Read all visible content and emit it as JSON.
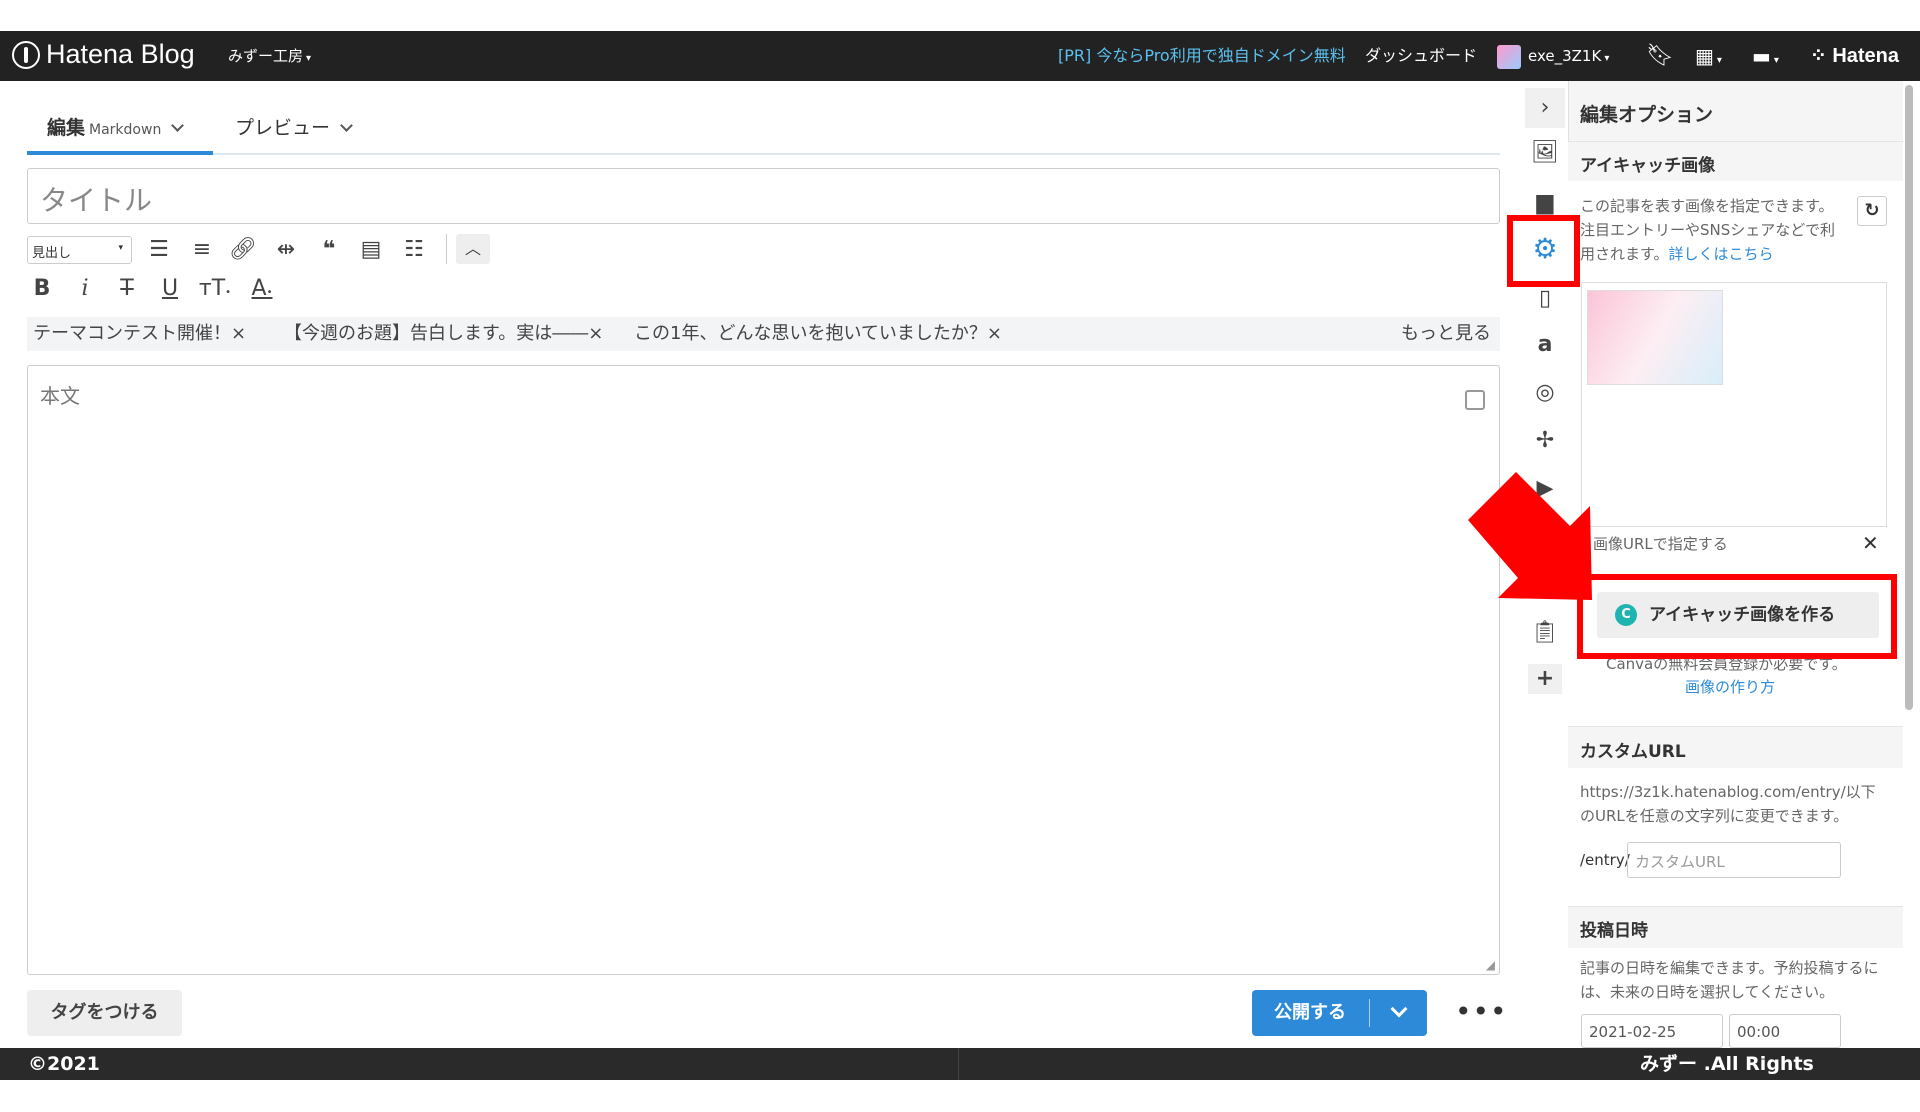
{
  "header": {
    "logo": "Hatena Blog",
    "blog_name": "みずー工房",
    "promo": "[PR] 今ならPro利用で独自ドメイン無料",
    "dashboard": "ダッシュボード",
    "username": "exe_3Z1K",
    "hatena": "Hatena"
  },
  "editor": {
    "tab_edit": "編集",
    "tab_edit_mode": "Markdown",
    "tab_preview": "プレビュー",
    "title_placeholder": "タイトル",
    "heading_select": "見出し",
    "themes": [
      "テーマコンテスト開催！×",
      "【今週のお題】告白します。実は――×",
      "この1年、どんな思いを抱いていましたか？×"
    ],
    "more": "もっと見る",
    "body_placeholder": "本文",
    "tag_button": "タグをつける",
    "publish": "公開する",
    "more_menu": "•••"
  },
  "panel": {
    "title": "編集オプション",
    "eyecatch": {
      "heading": "アイキャッチ画像",
      "desc": "この記事を表す画像を指定できます。注目エントリーやSNSシェアなどで利用されます。",
      "link": "詳しくはこちら",
      "url_label": "画像URLで指定する",
      "create_button": "アイキャッチ画像を作る",
      "canva_note": "Canvaの無料会員登録が必要です。",
      "howto_link": "画像の作り方"
    },
    "custom_url": {
      "heading": "カスタムURL",
      "desc": "https://3z1k.hatenablog.com/entry/以下のURLを任意の文字列に変更できます。",
      "prefix": "/entry/",
      "placeholder": "カスタムURL"
    },
    "post_date": {
      "heading": "投稿日時",
      "desc": "記事の日時を編集できます。予約投稿するには、未来の日時を選択してください。",
      "date": "2021-02-25",
      "time": "00:00"
    }
  },
  "footer": {
    "left": "©2021",
    "right": "みずー .All Rights Reserved"
  },
  "colors": {
    "accent": "#2c8ad8",
    "annotation": "#ff0000",
    "header": "#222222"
  }
}
